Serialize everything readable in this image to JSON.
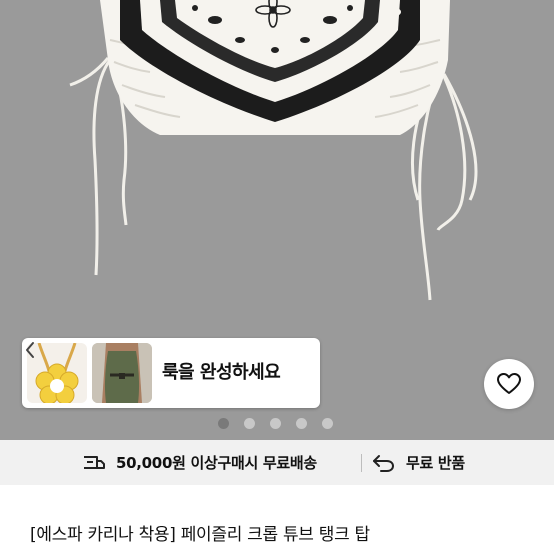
{
  "look_card": {
    "text": "룩을 완성하세요"
  },
  "carousel": {
    "total": 5,
    "active_index": 0
  },
  "shipping": {
    "free_shipping_label": "50,000원 이상구매시 무료배송",
    "free_return_label": "무료 반품"
  },
  "product": {
    "title": "[에스파 카리나 착용] 페이즐리 크롭 튜브 탱크 탑"
  },
  "colors": {
    "hero_bg": "#9a9a9a",
    "shipbar_bg": "#f1f1f1",
    "dot_active": "#7a7a7a",
    "dot_inactive": "#c8c8c8"
  },
  "icons": {
    "heart": "heart-icon",
    "chevron": "chevron-left-icon",
    "truck": "truck-icon",
    "return": "return-arrow-icon"
  }
}
